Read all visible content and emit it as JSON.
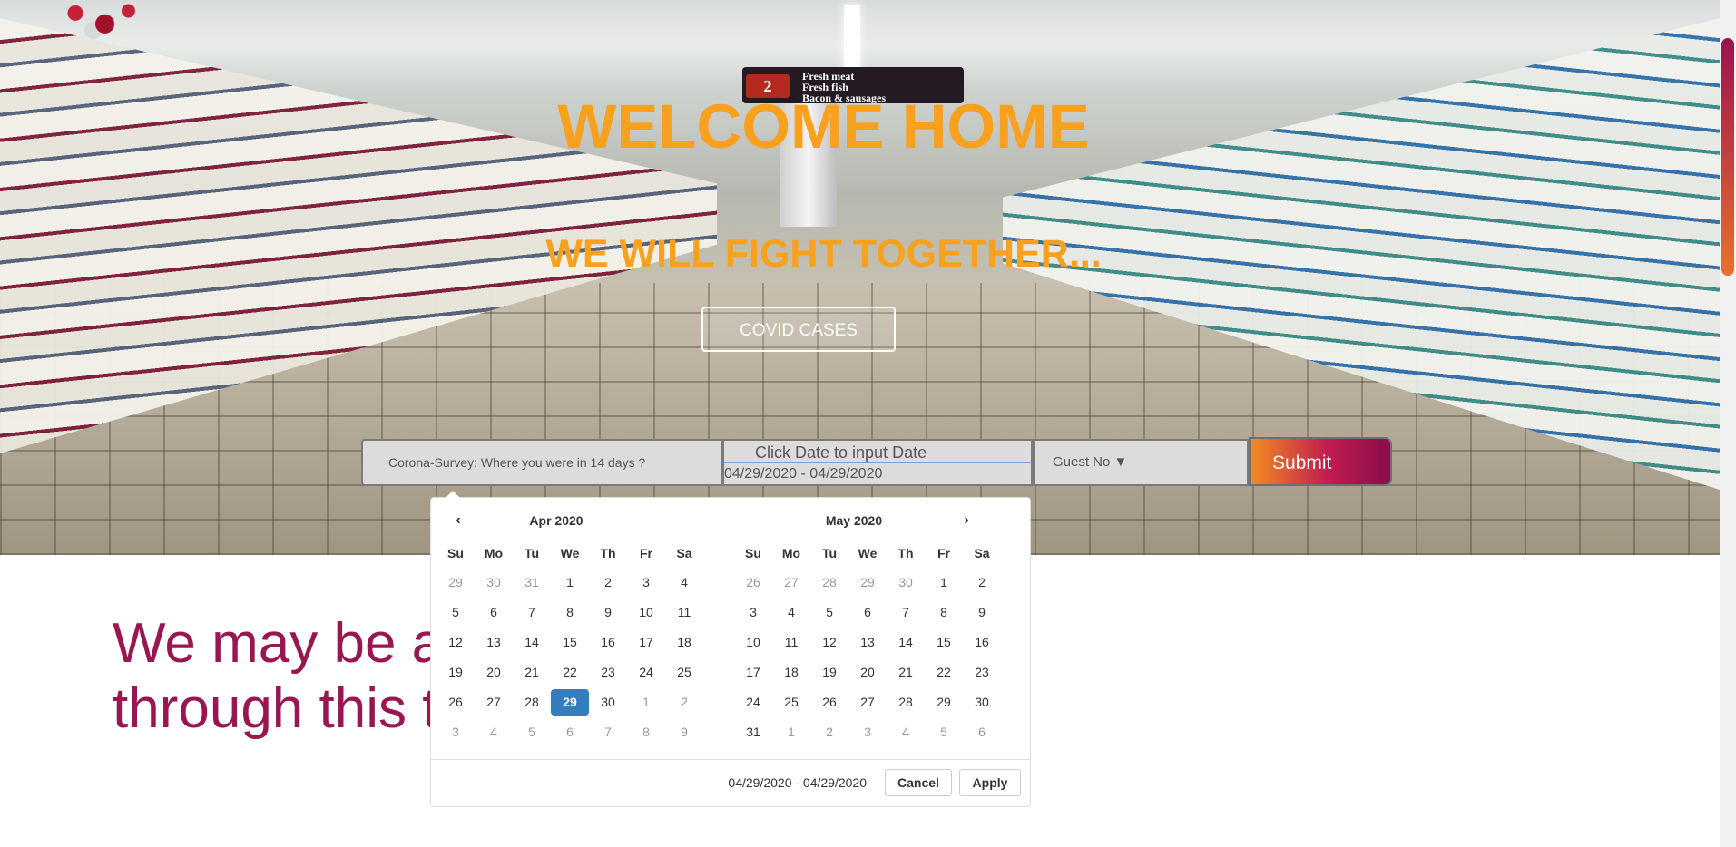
{
  "hero": {
    "title": "WELCOME HOME",
    "subtitle": "WE WILL FIGHT TOGETHER...",
    "covid_button": "COVID CASES",
    "aisle_sign": {
      "number": "2",
      "lines": [
        "Fresh meat",
        "Fresh fish",
        "Bacon & sausages"
      ]
    }
  },
  "search_bar": {
    "survey_placeholder": "Corona-Survey:  Where you were in 14 days ?",
    "date_label": "Click Date to input Date",
    "date_value": "04/29/2020 - 04/29/2020",
    "guest_label": "Guest No  ▼",
    "submit_label": "Submit"
  },
  "date_picker": {
    "weekdays": [
      "Su",
      "Mo",
      "Tu",
      "We",
      "Th",
      "Fr",
      "Sa"
    ],
    "prev_icon": "‹",
    "next_icon": "›",
    "left_month": {
      "label": "Apr 2020",
      "weeks": [
        [
          "29",
          "30",
          "31",
          "1",
          "2",
          "3",
          "4"
        ],
        [
          "5",
          "6",
          "7",
          "8",
          "9",
          "10",
          "11"
        ],
        [
          "12",
          "13",
          "14",
          "15",
          "16",
          "17",
          "18"
        ],
        [
          "19",
          "20",
          "21",
          "22",
          "23",
          "24",
          "25"
        ],
        [
          "26",
          "27",
          "28",
          "29",
          "30",
          "1",
          "2"
        ],
        [
          "3",
          "4",
          "5",
          "6",
          "7",
          "8",
          "9"
        ]
      ],
      "off_cells": [
        "0-0",
        "0-1",
        "0-2",
        "4-5",
        "4-6",
        "5-0",
        "5-1",
        "5-2",
        "5-3",
        "5-4",
        "5-5",
        "5-6"
      ],
      "active_cell": "4-3"
    },
    "right_month": {
      "label": "May 2020",
      "weeks": [
        [
          "26",
          "27",
          "28",
          "29",
          "30",
          "1",
          "2"
        ],
        [
          "3",
          "4",
          "5",
          "6",
          "7",
          "8",
          "9"
        ],
        [
          "10",
          "11",
          "12",
          "13",
          "14",
          "15",
          "16"
        ],
        [
          "17",
          "18",
          "19",
          "20",
          "21",
          "22",
          "23"
        ],
        [
          "24",
          "25",
          "26",
          "27",
          "28",
          "29",
          "30"
        ],
        [
          "31",
          "1",
          "2",
          "3",
          "4",
          "5",
          "6"
        ]
      ],
      "off_cells": [
        "0-0",
        "0-1",
        "0-2",
        "0-3",
        "0-4",
        "5-1",
        "5-2",
        "5-3",
        "5-4",
        "5-5",
        "5-6"
      ],
      "active_cell": ""
    },
    "selected_range": "04/29/2020 - 04/29/2020",
    "cancel_label": "Cancel",
    "apply_label": "Apply"
  },
  "tagline_lines": [
    "We may be a",
    "through this t"
  ],
  "colors": {
    "accent_orange": "#f7a11f",
    "tagline_maroon": "#991651",
    "active_blue": "#357ebd"
  }
}
